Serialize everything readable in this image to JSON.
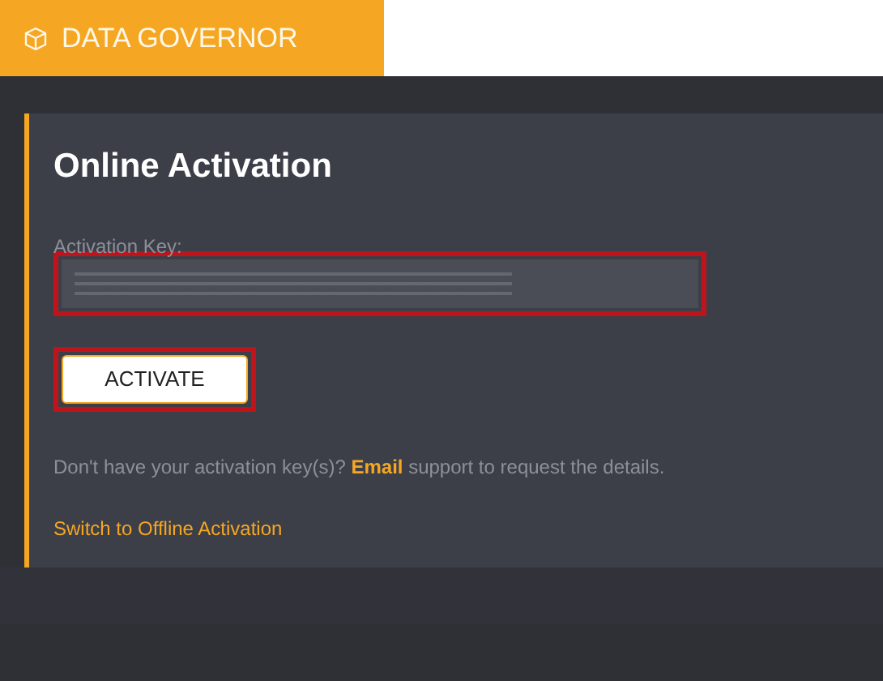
{
  "header": {
    "brand": "DATA GOVERNOR"
  },
  "card": {
    "title": "Online Activation",
    "key_field": {
      "label": "Activation Key:",
      "highlighted": true,
      "value_redacted": true
    },
    "activate_button": {
      "label": "ACTIVATE",
      "highlighted": true
    },
    "help_text": {
      "before": "Don't have your activation key(s)? ",
      "link": "Email",
      "after": " support to request the details."
    },
    "switch_link": "Switch to Offline Activation"
  }
}
